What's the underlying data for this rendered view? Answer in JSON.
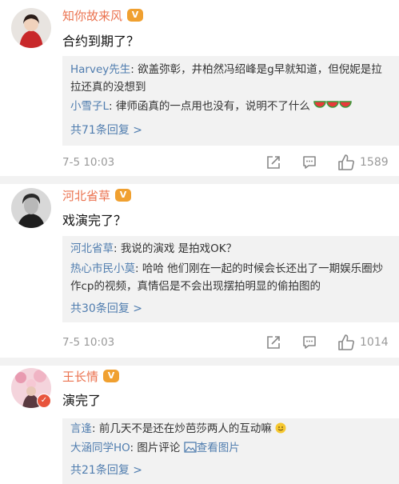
{
  "colors": {
    "username": "#eb7350",
    "link": "#507daf",
    "reply_bg": "#f2f2f2",
    "muted": "#999999"
  },
  "comments": [
    {
      "username": "知你故来风",
      "text": "合约到期了？",
      "replies": [
        {
          "user": "Harvey先生",
          "sep": ":",
          "text": " 欲盖弥彰，井柏然冯绍峰是g早就知道，但倪妮是拉拉还真的没想到"
        },
        {
          "user": "小雪子L",
          "sep": ":",
          "text": " 律师函真的一点用也没有，说明不了什么",
          "emoji": "watermelon-icon"
        }
      ],
      "more": "共71条回复 >",
      "time": "7-5 10:03",
      "likes": "1589"
    },
    {
      "username": "河北省草",
      "text": "戏演完了？",
      "replies": [
        {
          "user": "河北省草",
          "sep": ":",
          "text": " 我说的演戏 是拍戏OK？"
        },
        {
          "user": "热心市民小莫",
          "sep": ":",
          "text": " 哈哈 他们刚在一起的时候会长还出了一期娱乐圈炒作cp的视频，真情侣是不会出现摆拍明显的偷拍图的"
        }
      ],
      "more": "共30条回复 >",
      "time": "7-5 10:03",
      "likes": "1014"
    },
    {
      "username": "王长情",
      "text": "演完了",
      "replies": [
        {
          "user": "言逢",
          "sep": ":",
          "text": " 前几天不是还在炒芭莎两人的互动嘛",
          "emoji": "smile-icon"
        },
        {
          "user": "大涵同学HO",
          "sep": ":",
          "text": " 图片评论 ",
          "link": "查看图片"
        }
      ],
      "more": "共21条回复 >"
    }
  ]
}
